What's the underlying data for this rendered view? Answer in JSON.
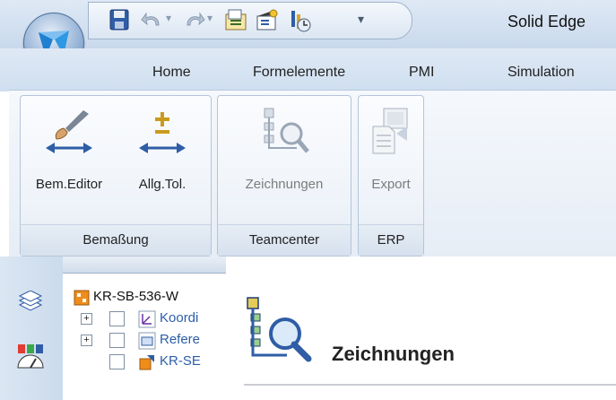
{
  "titlebar": {
    "app_title": "Solid Edge",
    "qat_icons": [
      "save-icon",
      "undo-icon",
      "redo-icon",
      "properties-icon",
      "clapper-icon",
      "tool-icon",
      "customize-chevron-icon"
    ]
  },
  "tabs": [
    {
      "label": "Home"
    },
    {
      "label": "Formelemente"
    },
    {
      "label": "PMI"
    },
    {
      "label": "Simulation"
    }
  ],
  "ribbon": {
    "groups": [
      {
        "label": "Bemaßung",
        "buttons": [
          {
            "label": "Bem.Editor"
          },
          {
            "label": "Allg.Tol."
          }
        ]
      },
      {
        "label": "Teamcenter",
        "buttons": [
          {
            "label": "Zeichnungen"
          }
        ]
      },
      {
        "label": "ERP",
        "buttons": [
          {
            "label": "Export"
          }
        ]
      }
    ]
  },
  "tree": {
    "items": [
      {
        "label": "KR-SB-536-W"
      },
      {
        "label": "Koordi"
      },
      {
        "label": "Refere"
      },
      {
        "label": "KR-SE"
      }
    ]
  },
  "document": {
    "title": "Zeichnungen"
  },
  "colors": {
    "ribbon_border": "#b4c5d9",
    "titlebar": "#c9d9ec",
    "disabled_text": "#7c7c7c"
  }
}
